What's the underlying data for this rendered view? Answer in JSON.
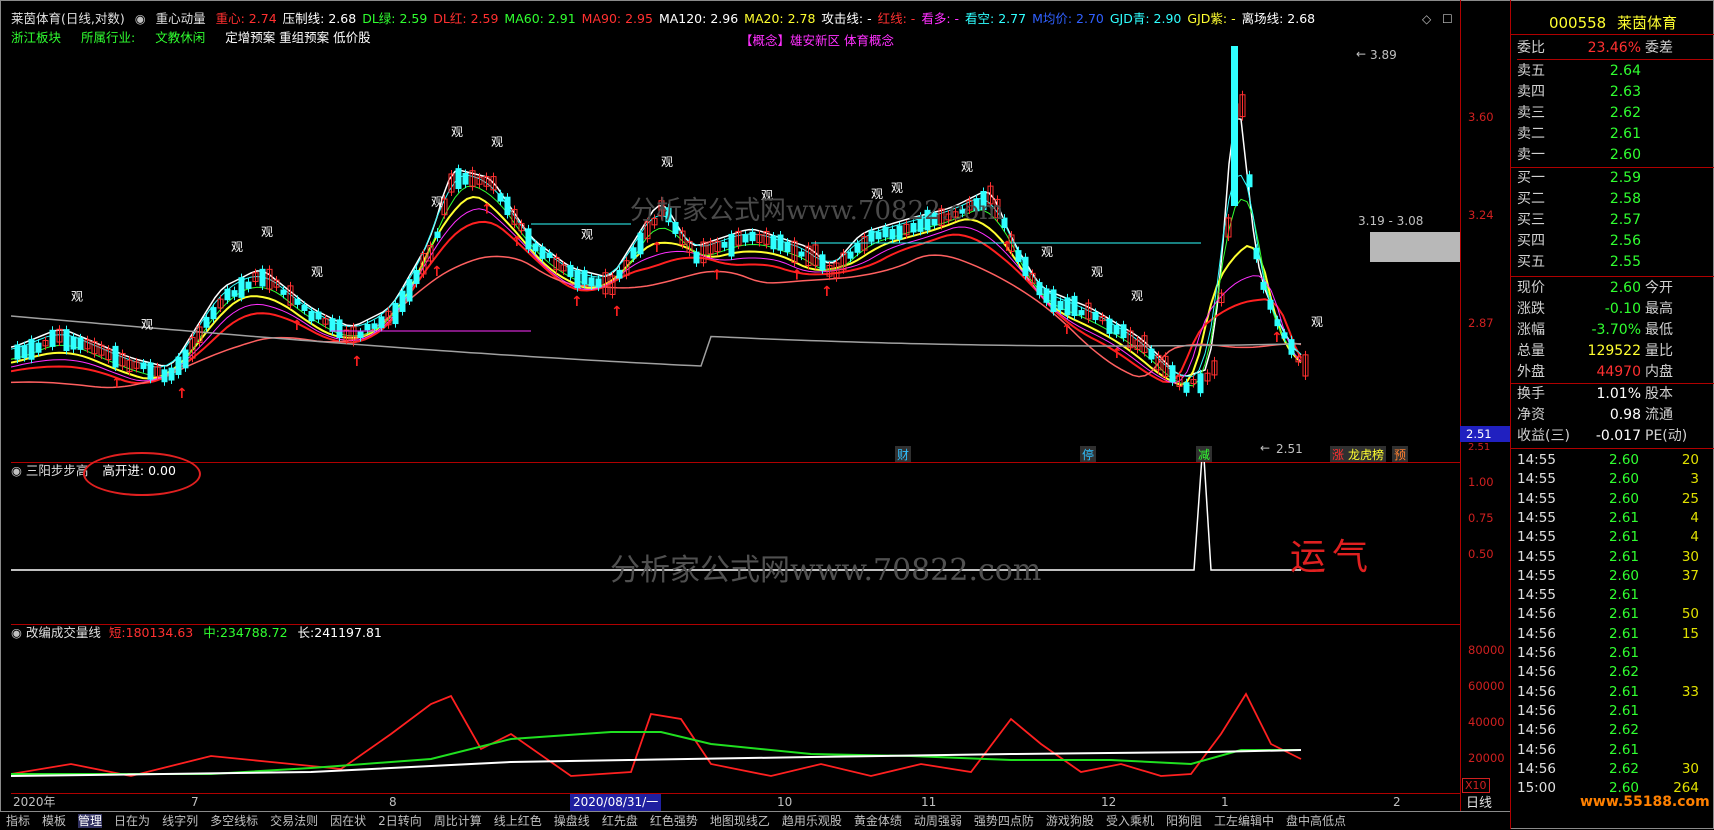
{
  "header": {
    "title": "莱茵体育(日线,对数)",
    "indicator_name": "重心动量",
    "items": [
      {
        "label": "重心:",
        "value": "2.74",
        "color": "#ff3030"
      },
      {
        "label": "压制线:",
        "value": "2.68",
        "color": "#ffffff"
      },
      {
        "label": "DL绿:",
        "value": "2.59",
        "color": "#30ff30"
      },
      {
        "label": "DL红:",
        "value": "2.59",
        "color": "#ff3030"
      },
      {
        "label": "MA60:",
        "value": "2.91",
        "color": "#30ff30"
      },
      {
        "label": "MA90:",
        "value": "2.95",
        "color": "#ff3030"
      },
      {
        "label": "MA120:",
        "value": "2.96",
        "color": "#ffffff"
      },
      {
        "label": "MA20:",
        "value": "2.78",
        "color": "#ffff30"
      },
      {
        "label": "攻击线:",
        "value": "-",
        "color": "#ffffff"
      },
      {
        "label": "红线:",
        "value": "-",
        "color": "#ff3030"
      },
      {
        "label": "看多:",
        "value": "-",
        "color": "#ff30ff"
      },
      {
        "label": "看空:",
        "value": "2.77",
        "color": "#30ffff"
      },
      {
        "label": "M均价:",
        "value": "2.70",
        "color": "#3060ff"
      },
      {
        "label": "GJD青:",
        "value": "2.90",
        "color": "#30ffff"
      },
      {
        "label": "GJD紫:",
        "value": "-",
        "color": "#ffff30"
      },
      {
        "label": "离场线:",
        "value": "2.68",
        "color": "#ffffff"
      }
    ],
    "row2": [
      {
        "text": "浙江板块",
        "color": "#30ff30"
      },
      {
        "text": "所属行业:",
        "color": "#30ff30"
      },
      {
        "text": "文教休闲",
        "color": "#30ff30"
      },
      {
        "text": "定增预案 重组预案 低价股",
        "color": "#ffffff"
      }
    ],
    "concept": "【概念】雄安新区 体育概念"
  },
  "main_chart": {
    "price_ticks": [
      "3.60",
      "3.24",
      "2.87",
      "2.51"
    ],
    "current_price_tag": "2.51",
    "high_label": "3.89",
    "mid_label": "3.19 - 3.08",
    "low_label": "2.51",
    "guan_labels": [
      "观",
      "观",
      "观",
      "观",
      "观",
      "观",
      "观",
      "观",
      "观",
      "观",
      "观",
      "观",
      "观",
      "观",
      "观",
      "观",
      "观",
      "观"
    ],
    "markers": [
      {
        "text": "财",
        "bg": "#303030",
        "color": "#30c0ff"
      },
      {
        "text": "停",
        "bg": "#303030",
        "color": "#30c0ff"
      },
      {
        "text": "减",
        "bg": "#303030",
        "color": "#30ff30"
      },
      {
        "text": "涨",
        "bg": "#303030",
        "color": "#ff3030"
      },
      {
        "text": "龙虎榜",
        "bg": "#303030",
        "color": "#ffff30"
      },
      {
        "text": "预",
        "bg": "#303030",
        "color": "#ff8030"
      }
    ]
  },
  "sub1": {
    "title": "三阳步步高",
    "item_label": "高开进:",
    "item_value": "0.00",
    "ticks": [
      "1.00",
      "0.75",
      "0.50"
    ],
    "handwriting": "运气"
  },
  "sub2": {
    "title": "改编成交量线",
    "items": [
      {
        "label": "短:",
        "value": "180134.63",
        "color": "#ff3030"
      },
      {
        "label": "中:",
        "value": "234788.72",
        "color": "#30ff30"
      },
      {
        "label": "长:",
        "value": "241197.81",
        "color": "#ffffff"
      }
    ],
    "ticks": [
      "80000",
      "60000",
      "40000",
      "20000"
    ],
    "unit": "X10"
  },
  "dates": [
    "2020年",
    "7",
    "8",
    "2020/08/31/一",
    "10",
    "11",
    "12",
    "1",
    "2"
  ],
  "bottom_tabs": [
    "指标",
    "模板",
    "管理",
    "日在为",
    "线字列",
    "多空线标",
    "交易法则",
    "因在状",
    "2日转向",
    "周比计算",
    "线上红色",
    "操盘线",
    "红先盘",
    "红色强势",
    "地图现线乙",
    "趋用乐观股",
    "黄金体绩",
    "动周强弱",
    "强势四点防",
    "游戏狗股",
    "受入乘机",
    "阳狗阻",
    "工左编辑中",
    "盘中高低点"
  ],
  "bottom_mode": "日线",
  "watermark": "分析家公式网www.70822.com",
  "corner_watermark": "www.55188.com",
  "right_panel": {
    "code": "000558",
    "name": "莱茵体育",
    "weibi_label": "委比",
    "weibi_value": "23.46%",
    "weicha_label": "委差",
    "asks": [
      {
        "label": "卖五",
        "price": "2.64"
      },
      {
        "label": "卖四",
        "price": "2.63"
      },
      {
        "label": "卖三",
        "price": "2.62"
      },
      {
        "label": "卖二",
        "price": "2.61"
      },
      {
        "label": "卖一",
        "price": "2.60"
      }
    ],
    "bids": [
      {
        "label": "买一",
        "price": "2.59"
      },
      {
        "label": "买二",
        "price": "2.58"
      },
      {
        "label": "买三",
        "price": "2.57"
      },
      {
        "label": "买四",
        "price": "2.56"
      },
      {
        "label": "买五",
        "price": "2.55"
      }
    ],
    "stats": [
      {
        "label": "现价",
        "value": "2.60",
        "color": "#30ff30",
        "label2": "今开"
      },
      {
        "label": "涨跌",
        "value": "-0.10",
        "color": "#30ff30",
        "label2": "最高"
      },
      {
        "label": "涨幅",
        "value": "-3.70%",
        "color": "#30ff30",
        "label2": "最低"
      },
      {
        "label": "总量",
        "value": "129522",
        "color": "#ffff30",
        "label2": "量比"
      },
      {
        "label": "外盘",
        "value": "44970",
        "color": "#ff3030",
        "label2": "内盘"
      }
    ],
    "stats2": [
      {
        "label": "换手",
        "value": "1.01%",
        "label2": "股本"
      },
      {
        "label": "净资",
        "value": "0.98",
        "label2": "流通"
      },
      {
        "label": "收益(三)",
        "value": "-0.017",
        "label2": "PE(动)"
      }
    ],
    "ticks": [
      {
        "time": "14:55",
        "price": "2.60",
        "vol": "20",
        "pc": "#30ff30"
      },
      {
        "time": "14:55",
        "price": "2.60",
        "vol": "3",
        "pc": "#30ff30"
      },
      {
        "time": "14:55",
        "price": "2.60",
        "vol": "25",
        "pc": "#30ff30"
      },
      {
        "time": "14:55",
        "price": "2.61",
        "vol": "4",
        "pc": "#30ff30"
      },
      {
        "time": "14:55",
        "price": "2.61",
        "vol": "4",
        "pc": "#30ff30"
      },
      {
        "time": "14:55",
        "price": "2.61",
        "vol": "30",
        "pc": "#30ff30"
      },
      {
        "time": "14:55",
        "price": "2.60",
        "vol": "37",
        "pc": "#30ff30"
      },
      {
        "time": "14:55",
        "price": "2.61",
        "vol": "",
        "pc": "#30ff30"
      },
      {
        "time": "14:56",
        "price": "2.61",
        "vol": "50",
        "pc": "#30ff30"
      },
      {
        "time": "14:56",
        "price": "2.61",
        "vol": "15",
        "pc": "#30ff30"
      },
      {
        "time": "14:56",
        "price": "2.61",
        "vol": "",
        "pc": "#30ff30"
      },
      {
        "time": "14:56",
        "price": "2.62",
        "vol": "",
        "pc": "#30ff30"
      },
      {
        "time": "14:56",
        "price": "2.61",
        "vol": "33",
        "pc": "#30ff30"
      },
      {
        "time": "14:56",
        "price": "2.61",
        "vol": "",
        "pc": "#30ff30"
      },
      {
        "time": "14:56",
        "price": "2.62",
        "vol": "",
        "pc": "#30ff30"
      },
      {
        "time": "14:56",
        "price": "2.61",
        "vol": "",
        "pc": "#30ff30"
      },
      {
        "time": "14:56",
        "price": "2.62",
        "vol": "30",
        "pc": "#30ff30"
      },
      {
        "time": "15:00",
        "price": "2.60",
        "vol": "264",
        "pc": "#30ff30"
      }
    ]
  }
}
